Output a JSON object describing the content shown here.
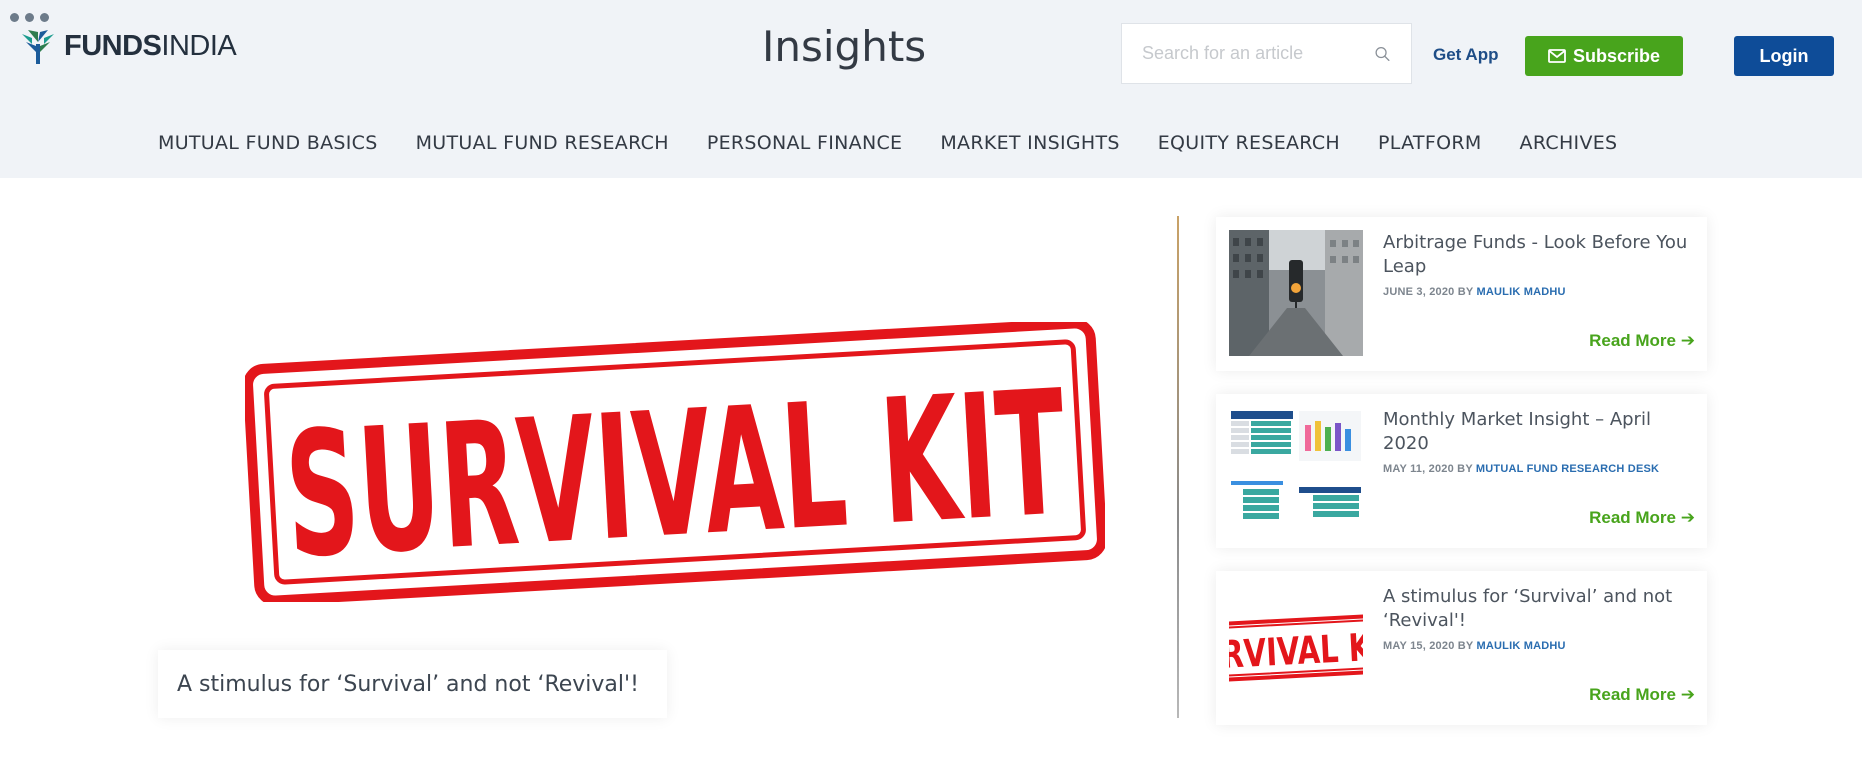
{
  "header": {
    "brand": {
      "bold": "FUNDS",
      "light": "INDIA"
    },
    "page_title": "Insights",
    "search": {
      "placeholder": "Search for an article",
      "value": ""
    },
    "get_app_label": "Get App",
    "subscribe_label": "Subscribe",
    "login_label": "Login",
    "colors": {
      "background": "#f0f3f7",
      "subscribe": "#48a41c",
      "login": "#0e4c98",
      "link": "#1e4d87"
    }
  },
  "nav": {
    "items": [
      {
        "label": "MUTUAL FUND BASICS"
      },
      {
        "label": "MUTUAL FUND RESEARCH"
      },
      {
        "label": "PERSONAL FINANCE"
      },
      {
        "label": "MARKET INSIGHTS"
      },
      {
        "label": "EQUITY RESEARCH"
      },
      {
        "label": "PLATFORM"
      },
      {
        "label": "ARCHIVES"
      }
    ]
  },
  "hero": {
    "image_text": "SURVIVAL KIT",
    "caption": "A stimulus for ‘Survival’ and not ‘Revival'!"
  },
  "sidebar": {
    "cards": [
      {
        "title": "Arbitrage Funds - Look Before You Leap",
        "date": "JUNE 3, 2020",
        "by": "BY",
        "author": "MAULIK MADHU",
        "read_more": "Read More",
        "thumb_icon": "city-street-image"
      },
      {
        "title": "Monthly Market Insight – April 2020",
        "date": "MAY 11, 2020",
        "by": "BY",
        "author": "MUTUAL FUND RESEARCH DESK",
        "read_more": "Read More",
        "thumb_icon": "market-tables-image"
      },
      {
        "title": "A stimulus for ‘Survival’ and not ‘Revival'!",
        "date": "MAY 15, 2020",
        "by": "BY",
        "author": "MAULIK MADHU",
        "read_more": "Read More",
        "thumb_icon": "survival-kit-stamp-image",
        "thumb_text": "RVIVAL K"
      }
    ]
  }
}
